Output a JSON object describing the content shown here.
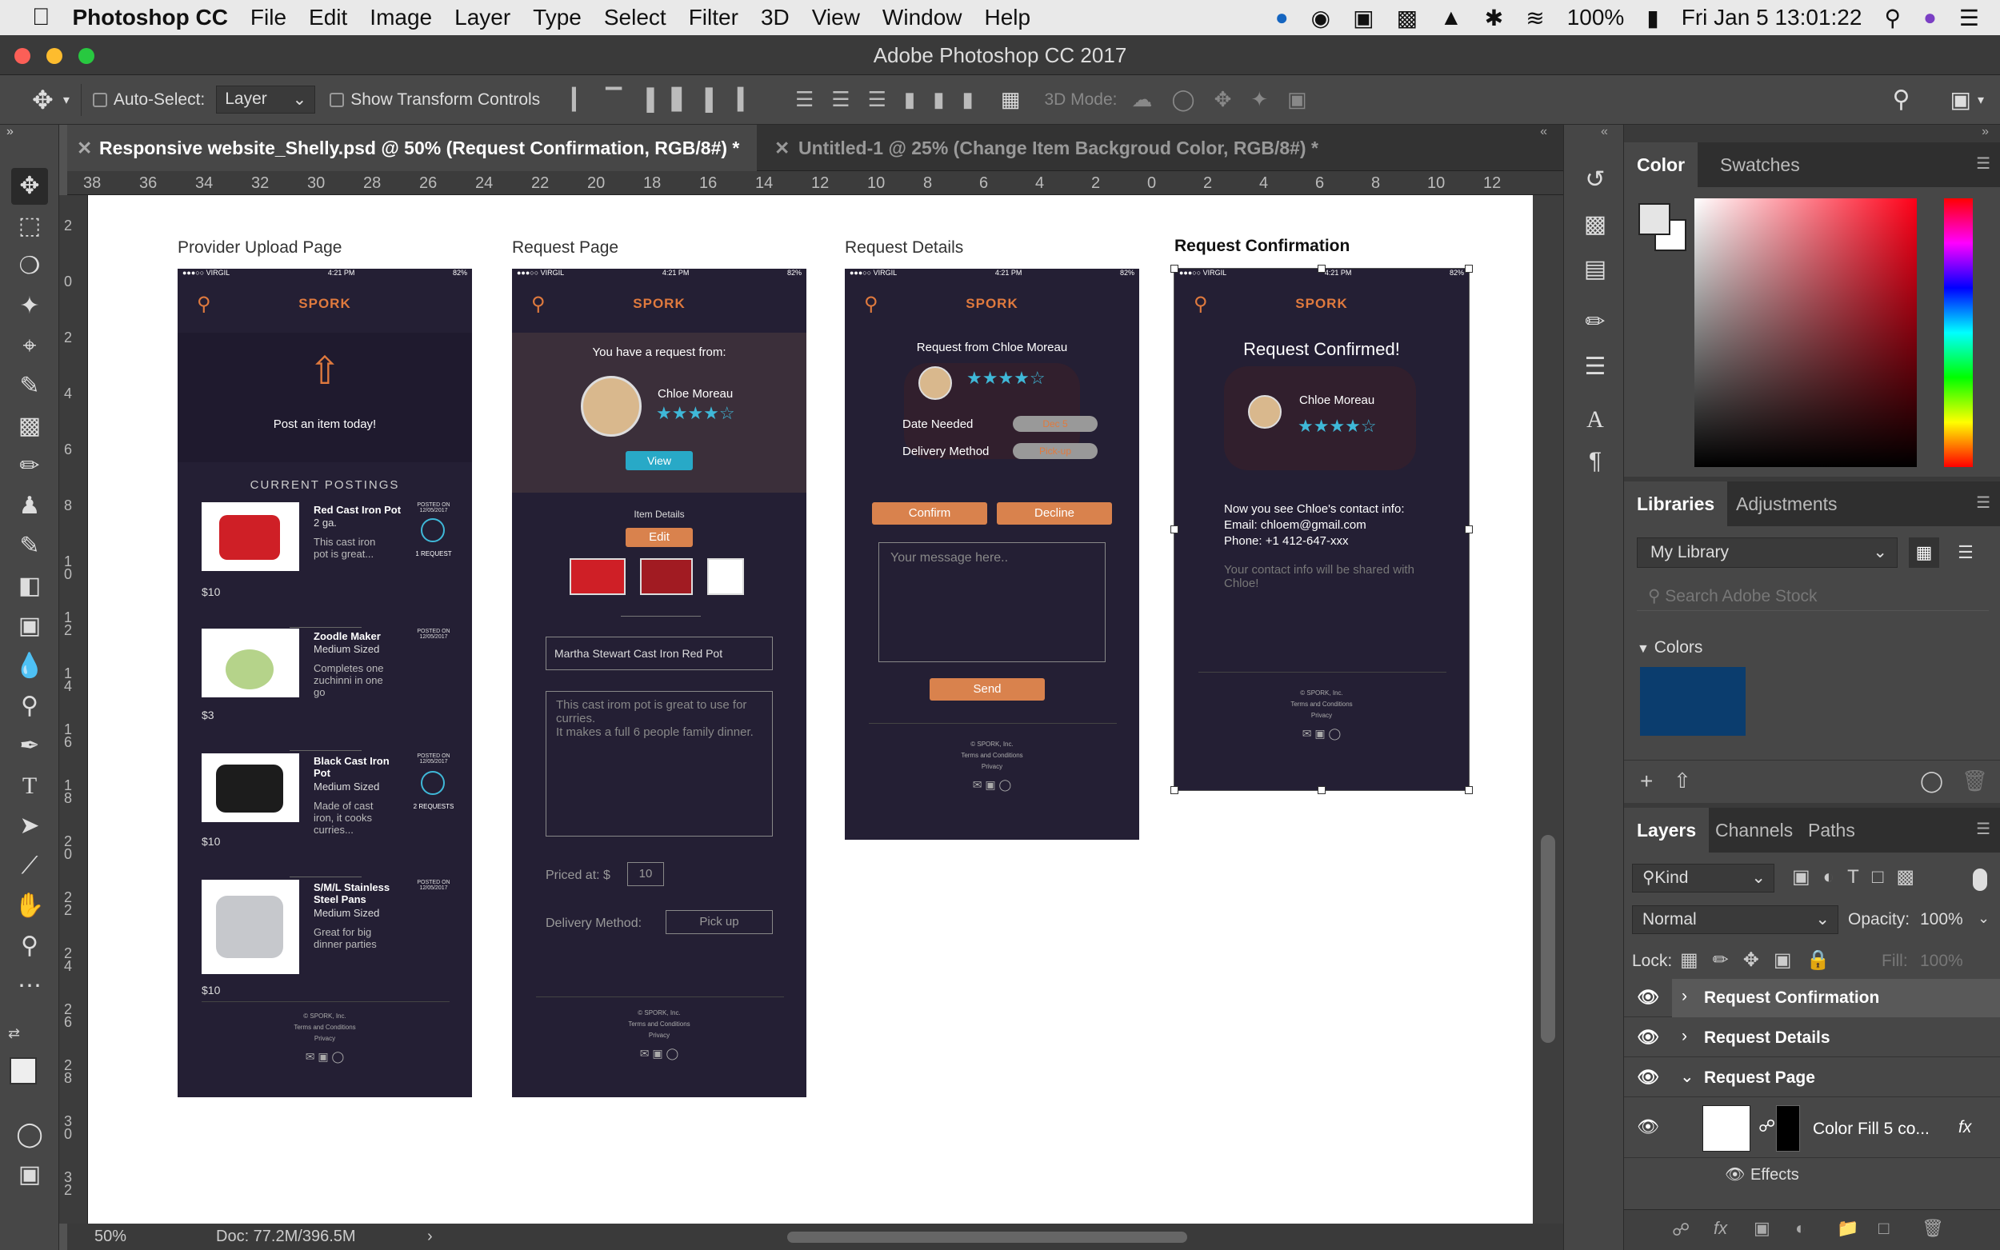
{
  "menubar": {
    "app": "Photoshop CC",
    "items": [
      "File",
      "Edit",
      "Image",
      "Layer",
      "Type",
      "Select",
      "Filter",
      "3D",
      "View",
      "Window",
      "Help"
    ],
    "battery": "100%",
    "datetime": "Fri Jan 5  13:01:22"
  },
  "window": {
    "title": "Adobe Photoshop CC 2017"
  },
  "options": {
    "auto_select": "Auto-Select:",
    "layer_select": "Layer",
    "show_transform": "Show Transform Controls",
    "mode_3d": "3D Mode:"
  },
  "tabs": [
    {
      "label": "Responsive website_Shelly.psd @ 50% (Request Confirmation, RGB/8#) *"
    },
    {
      "label": "Untitled-1 @ 25% (Change Item Backgroud Color, RGB/8#) *"
    }
  ],
  "ruler": {
    "top": [
      "38",
      "36",
      "34",
      "32",
      "30",
      "28",
      "26",
      "24",
      "22",
      "20",
      "18",
      "16",
      "14",
      "12",
      "10",
      "8",
      "6",
      "4",
      "2",
      "0",
      "2",
      "4",
      "6",
      "8",
      "10",
      "12"
    ],
    "left": [
      "2",
      "0",
      "2",
      "4",
      "6",
      "8",
      "1 0",
      "1 2",
      "1 4",
      "1 6",
      "1 8",
      "2 0",
      "2 2",
      "2 4",
      "2 6",
      "2 8",
      "3 0",
      "3 2"
    ]
  },
  "artboards": {
    "provider": {
      "label": "Provider Upload Page",
      "carrier": "●●●○○ VIRGIL",
      "time": "4:21 PM",
      "battery": "82%",
      "logo": "SPORK",
      "post_cta": "Post an item today!",
      "section": "CURRENT POSTINGS",
      "items": [
        {
          "name": "Red Cast Iron Pot",
          "size": "2 ga.",
          "desc": "This cast iron pot is great...",
          "price": "$10",
          "posted": "POSTED ON 12/05/2017",
          "requests": "1 REQUEST"
        },
        {
          "name": "Zoodle Maker",
          "size": "Medium Sized",
          "desc": "Completes one zuchinni in one go",
          "price": "$3",
          "posted": "POSTED ON 12/05/2017",
          "requests": ""
        },
        {
          "name": "Black Cast Iron Pot",
          "size": "Medium Sized",
          "desc": "Made of cast iron, it cooks curries...",
          "price": "$10",
          "posted": "POSTED ON 12/05/2017",
          "requests": "2 REQUESTS"
        },
        {
          "name": "S/M/L Stainless Steel Pans",
          "size": "Medium Sized",
          "desc": "Great for big dinner parties",
          "price": "$10",
          "posted": "POSTED ON 12/05/2017",
          "requests": ""
        }
      ],
      "footer": [
        "© SPORK, Inc.",
        "Terms and Conditions",
        "Privacy"
      ]
    },
    "request": {
      "label": "Request Page",
      "carrier": "●●●○○ VIRGIL",
      "time": "4:21 PM",
      "battery": "82%",
      "logo": "SPORK",
      "hero_text": "You have a request from:",
      "name": "Chloe Moreau",
      "view": "View",
      "item_details": "Item Details",
      "edit": "Edit",
      "title_value": "Martha Stewart Cast Iron Red Pot",
      "desc_value": "This cast irom pot is great to use for curries.\nIt makes a full 6 people family dinner.",
      "price_label": "Priced at: $",
      "price_value": "10",
      "delivery_label": "Delivery Method:",
      "delivery_value": "Pick up",
      "footer": [
        "© SPORK, Inc.",
        "Terms and Conditions",
        "Privacy"
      ]
    },
    "details": {
      "label": "Request Details",
      "carrier": "●●●○○ VIRGIL",
      "time": "4:21 PM",
      "battery": "82%",
      "logo": "SPORK",
      "heading": "Request from Chloe Moreau",
      "date_label": "Date Needed",
      "date_value": "Dec 5",
      "method_label": "Delivery Method",
      "method_value": "Pick-up",
      "confirm": "Confirm",
      "decline": "Decline",
      "message_placeholder": "Your message here..",
      "send": "Send",
      "footer": [
        "© SPORK, Inc.",
        "Terms and Conditions",
        "Privacy"
      ]
    },
    "confirmation": {
      "label": "Request Confirmation",
      "carrier": "●●●○○ VIRGIL",
      "time": "4:21 PM",
      "battery": "82%",
      "logo": "SPORK",
      "heading": "Request Confirmed!",
      "name": "Chloe Moreau",
      "info1": "Now you see Chloe's contact info:",
      "email": "Email: chloem@gmail.com",
      "phone": "Phone: +1 412-647-xxx",
      "note": "Your contact info will be shared with Chloe!",
      "footer": [
        "© SPORK, Inc.",
        "Terms and Conditions",
        "Privacy"
      ]
    }
  },
  "status": {
    "zoom": "50%",
    "doc": "Doc: 77.2M/396.5M"
  },
  "color_panel": {
    "tabs": [
      "Color",
      "Swatches"
    ]
  },
  "libraries": {
    "tabs": [
      "Libraries",
      "Adjustments"
    ],
    "library": "My Library",
    "search_placeholder": "Search Adobe Stock",
    "colors_label": "Colors",
    "swatch_color": "#0b3d6e"
  },
  "layers": {
    "tabs": [
      "Layers",
      "Channels",
      "Paths"
    ],
    "kind": "Kind",
    "blend": "Normal",
    "opacity_label": "Opacity:",
    "opacity": "100%",
    "lock_label": "Lock:",
    "fill_label": "Fill:",
    "fill": "100%",
    "rows": [
      {
        "name": "Request Confirmation"
      },
      {
        "name": "Request Details"
      },
      {
        "name": "Request Page"
      }
    ],
    "fill_layer": "Color Fill 5 co...",
    "effects": "Effects"
  }
}
